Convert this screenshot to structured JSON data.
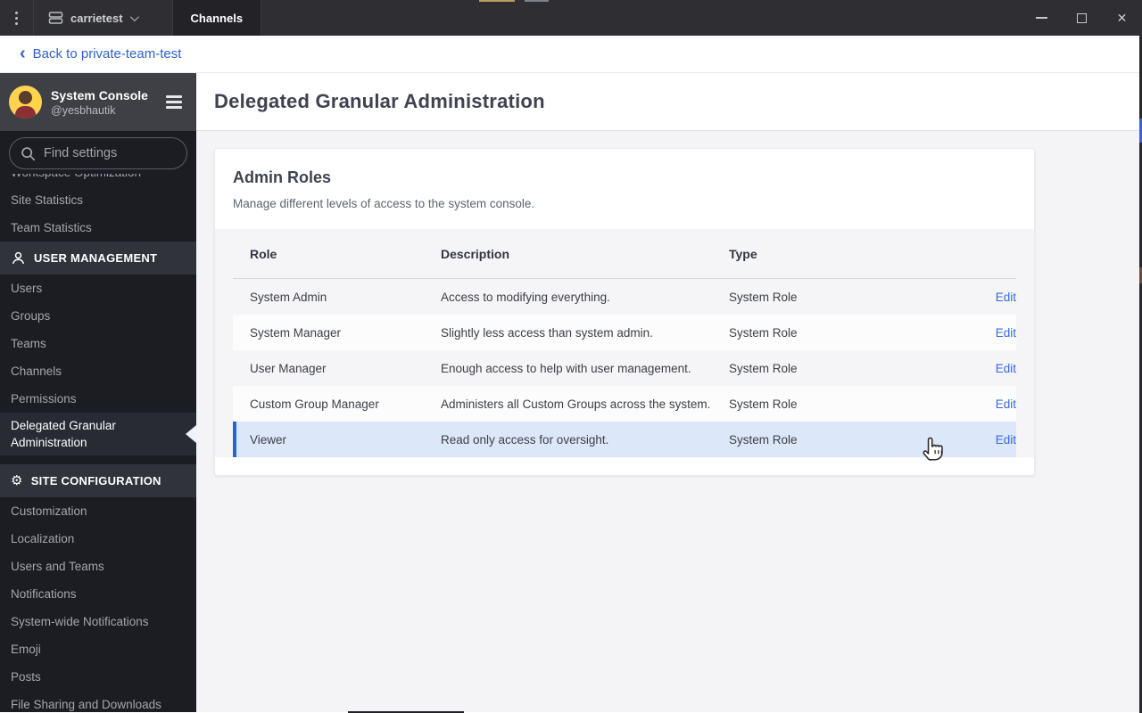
{
  "titlebar": {
    "server_name": "carrietest",
    "tab_label": "Channels"
  },
  "icons": {
    "kebab_menu": "vertical-dots",
    "server": "stacked-rectangles",
    "chevron_down": "chevron",
    "minimize": "bar",
    "maximize": "square",
    "close": "✕",
    "back_chevron": "‹",
    "search": "magnifier",
    "hamburger": "three-bars",
    "user_management": "person-silhouette",
    "site_configuration": "⚙",
    "selected_pointer": "left-triangle",
    "cursor": "hand-pointer"
  },
  "back_link": {
    "label": "Back to private-team-test"
  },
  "sidebar": {
    "header": {
      "title": "System Console",
      "subtitle": "@yesbhautik"
    },
    "search": {
      "placeholder": "Find settings"
    },
    "selected_item": "Delegated Granular Administration",
    "groups": [
      {
        "header": null,
        "icon": null,
        "items": [
          "Workspace Optimization",
          "Site Statistics",
          "Team Statistics"
        ]
      },
      {
        "header": "USER MANAGEMENT",
        "icon": "person",
        "items": [
          "Users",
          "Groups",
          "Teams",
          "Channels",
          "Permissions",
          "Delegated Granular Administration"
        ]
      },
      {
        "header": "SITE CONFIGURATION",
        "icon": "gear",
        "items": [
          "Customization",
          "Localization",
          "Users and Teams",
          "Notifications",
          "System-wide Notifications",
          "Emoji",
          "Posts",
          "File Sharing and Downloads"
        ]
      }
    ]
  },
  "main": {
    "title": "Delegated Granular Administration",
    "card": {
      "title": "Admin Roles",
      "description": "Manage different levels of access to the system console.",
      "table": {
        "columns": [
          "Role",
          "Description",
          "Type"
        ],
        "action_label": "Edit",
        "selected_row": "Viewer",
        "rows": [
          {
            "role": "System Admin",
            "description": "Access to modifying everything.",
            "type": "System Role"
          },
          {
            "role": "System Manager",
            "description": "Slightly less access than system admin.",
            "type": "System Role"
          },
          {
            "role": "User Manager",
            "description": "Enough access to help with user management.",
            "type": "System Role"
          },
          {
            "role": "Custom Group Manager",
            "description": "Administers all Custom Groups across the system.",
            "type": "System Role"
          },
          {
            "role": "Viewer",
            "description": "Read only access for oversight.",
            "type": "System Role"
          }
        ]
      }
    }
  },
  "colors": {
    "accent_blue": "#2d63c9",
    "selected_row_bg": "#dce7f9",
    "sidebar_bg": "#1b1d23",
    "titlebar_bg": "#2e2e33",
    "avatar_yellow": "#ffd34e"
  }
}
